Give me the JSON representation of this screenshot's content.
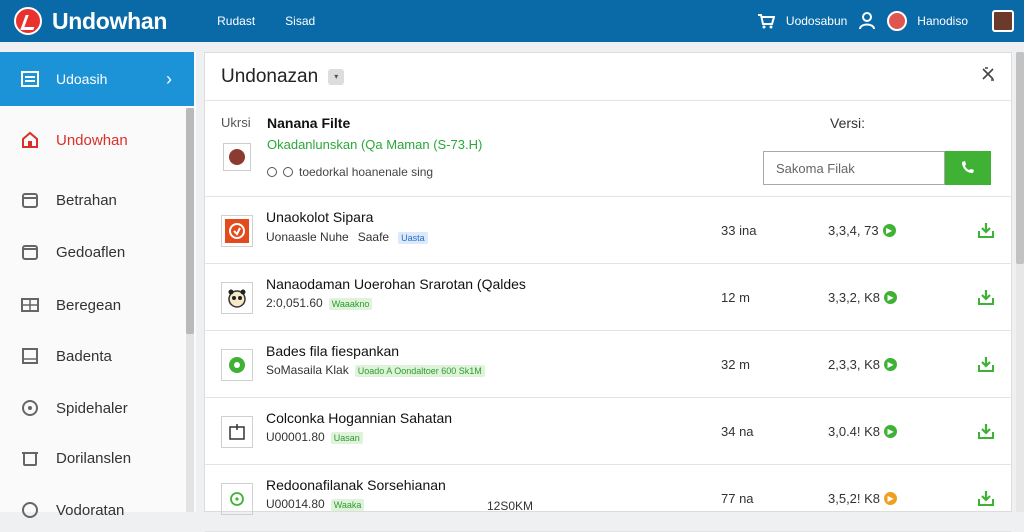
{
  "header": {
    "brand": "Undowhan",
    "nav": [
      "Rudast",
      "Sisad"
    ],
    "user_text": "Uodosabun",
    "account_text": "Hanodiso"
  },
  "sidebar": {
    "active": {
      "label": "Udoasih",
      "icon": "list-icon"
    },
    "items": [
      {
        "label": "Undowhan",
        "icon": "home-icon",
        "highlight": true
      },
      {
        "label": "Betrahan",
        "icon": "box-icon"
      },
      {
        "label": "Gedoaflen",
        "icon": "folder-icon"
      },
      {
        "label": "Beregean",
        "icon": "grid-icon"
      },
      {
        "label": "Badenta",
        "icon": "image-icon"
      },
      {
        "label": "Spidehaler",
        "icon": "disc-icon"
      },
      {
        "label": "Dorilanslen",
        "icon": "trash-icon"
      },
      {
        "label": "Vodoratan",
        "icon": "settings-icon"
      }
    ]
  },
  "panel": {
    "title": "Undonazan",
    "close_icon": "expand-icon",
    "info": {
      "user_label": "Ukrsi",
      "file_name": "Nanana Filte",
      "green_text": "Okadanlunskan (Qa Maman (S-73.H)",
      "meta": "toedorkal hoanenale sing",
      "version_label": "Versi:"
    },
    "search": {
      "placeholder": "Sakoma Filak"
    }
  },
  "files": [
    {
      "title": "Unaokolot Sipara",
      "sub": "Uonaasle Nuhe",
      "tag": "Saafe",
      "tag2": "Uasta",
      "size": "33 ina",
      "version": "3,3,4, 73",
      "status": "green",
      "icon": "app-red"
    },
    {
      "title": "Nanaodaman Uoerohan Srarotan (Qaldes",
      "sub": "2:0,051.60",
      "tag": "Waaakno",
      "size": "12 m",
      "version": "3,3,2, K8",
      "status": "green",
      "icon": "panda"
    },
    {
      "title": "Bades fila fiespankan",
      "sub": "SoMasaila Klak",
      "tag": "Uoado A Oondaltoer 600 Sk1M",
      "size": "32 m",
      "version": "2,3,3, K8",
      "status": "green",
      "icon": "green-circle"
    },
    {
      "title": "Colconka Hogannian Sahatan",
      "sub": "U00001.80",
      "tag": "Uasan",
      "size": "34 na",
      "version": "3,0.4! K8",
      "status": "green",
      "icon": "box"
    },
    {
      "title": "Redoonafilanak Sorsehianan",
      "sub": "U00014.80",
      "tag": "Waaka",
      "size": "77 na",
      "version": "3,5,2! K8",
      "status": "orange",
      "extra": "12S0KM",
      "icon": "green-ring"
    }
  ],
  "colors": {
    "topbar": "#0a6aa8",
    "accent": "#1b93d6",
    "green": "#3fb236",
    "red": "#d9302a",
    "orange": "#f0a020"
  }
}
